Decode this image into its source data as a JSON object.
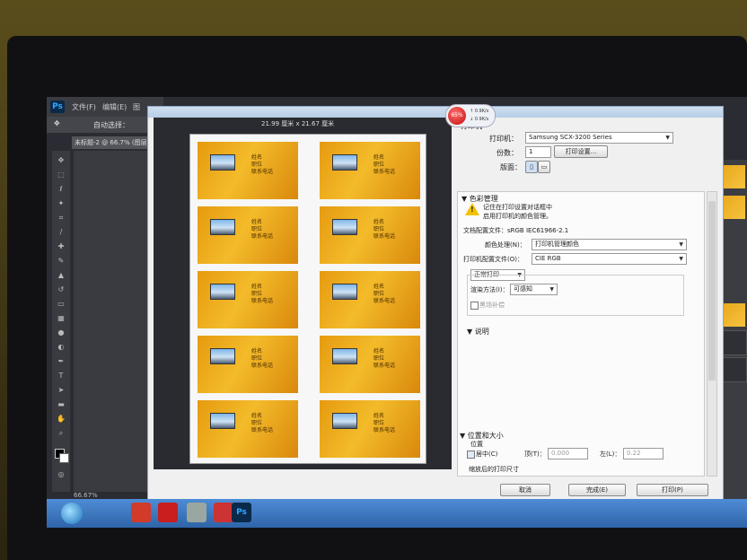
{
  "photoshop": {
    "logo": "Ps",
    "menus": [
      "文件(F)",
      "编辑(E)",
      "图"
    ],
    "tool_option": "自动选择：",
    "doc_tab": "未标题-2 @ 66.7% (图层",
    "status_zoom": "66.67%"
  },
  "preview": {
    "paper_size": "21.99 厘米 x 21.67 厘米",
    "card_lines": [
      "姓名",
      "职位",
      "联系电话"
    ],
    "below_labels": [
      "",
      "",
      ""
    ]
  },
  "network_indicator": {
    "percent": "65%",
    "up": "↑ 0.9K/s",
    "down": "↓ 0.9K/s"
  },
  "dialog": {
    "printer_section_label": "打印机",
    "printer_label": "打印机：",
    "printer_value": "Samsung SCX-3200 Series",
    "copies_label": "份数：",
    "copies_value": "1",
    "print_setup_button": "打印设置...",
    "layout_label": "版面：",
    "color_management": {
      "header": "▼ 色彩管理",
      "warning_line1": "记住在打印设置对话框中",
      "warning_line2": "启用打印机的颜色管理。",
      "document_profile": "文档配置文件：sRGB IEC61966-2.1",
      "color_handling_label": "颜色处理(N)：",
      "color_handling_value": "打印机管理颜色",
      "printer_profile_label": "打印机配置文件(O)：",
      "printer_profile_value": "CIE RGB",
      "normal_print": "正常打印",
      "rendering_label": "渲染方法(I)：",
      "rendering_value": "可感知",
      "black_point_label": "黑场补偿"
    },
    "description_header": "▼ 说明",
    "position_size": {
      "header": "▼ 位置和大小",
      "position_label": "位置",
      "center_label": "居中(C)",
      "top_label": "顶(T)：",
      "top_value": "0.000",
      "left_label": "左(L)：",
      "left_value": "0.22"
    },
    "scaled_label": "缩放后的打印尺寸",
    "cancel_button": "取消",
    "done_button": "完成(E)",
    "print_button": "打印(P)"
  },
  "taskbar": {
    "clock": ""
  }
}
